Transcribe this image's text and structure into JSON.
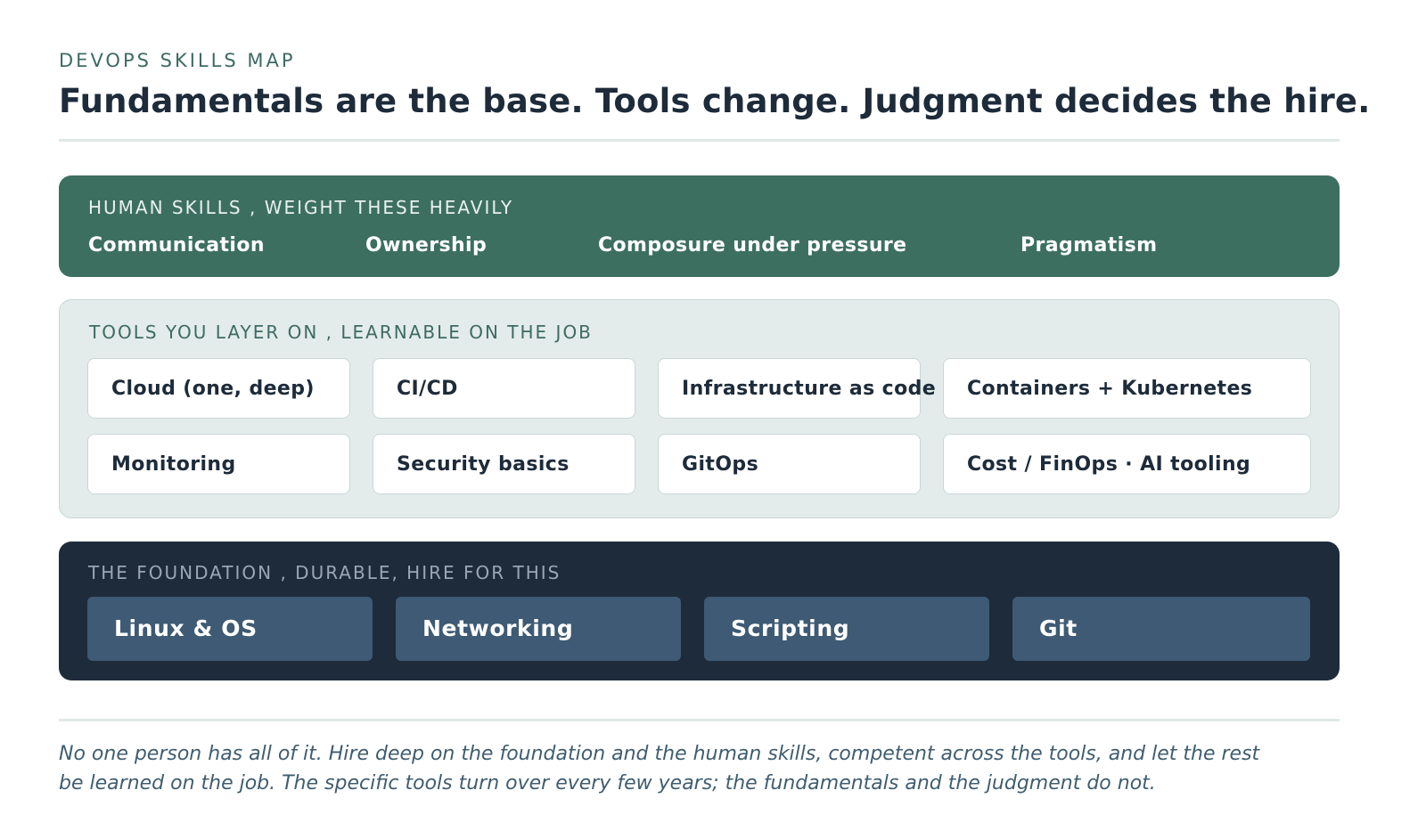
{
  "header": {
    "eyebrow": "DEVOPS SKILLS MAP",
    "title": "Fundamentals are the base. Tools change. Judgment decides the hire."
  },
  "human_skills": {
    "label": "HUMAN SKILLS , WEIGHT THESE HEAVILY",
    "items": [
      "Communication",
      "Ownership",
      "Composure under pressure",
      "Pragmatism"
    ]
  },
  "tools": {
    "label": "TOOLS YOU LAYER ON , LEARNABLE ON THE JOB",
    "items": [
      "Cloud (one, deep)",
      "CI/CD",
      "Infrastructure as code",
      "Containers + Kubernetes",
      "Monitoring",
      "Security basics",
      "GitOps",
      "Cost / FinOps · AI tooling"
    ]
  },
  "foundation": {
    "label": "THE FOUNDATION , DURABLE, HIRE FOR THIS",
    "items": [
      "Linux & OS",
      "Networking",
      "Scripting",
      "Git"
    ]
  },
  "footer": {
    "note": "No one person has all of it. Hire deep on the foundation and the human skills, competent across the tools, and let the rest be learned on the job. The specific tools turn over every few years; the fundamentals and the judgment do not."
  },
  "colors": {
    "human_layer": "#3d6f61",
    "tools_layer": "#e3ecea",
    "foundation_layer": "#1e2b3b",
    "foundation_card": "#3e5a74",
    "text_dark": "#1d2b3a"
  }
}
